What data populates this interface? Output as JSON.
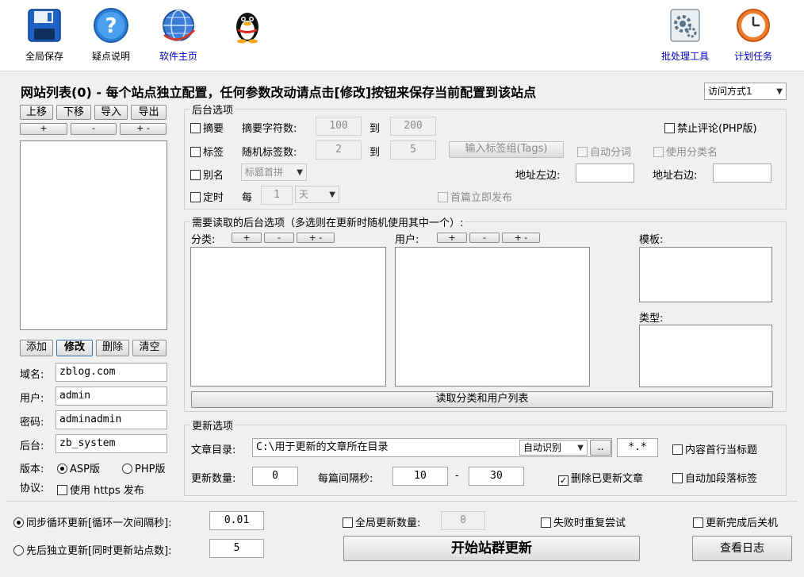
{
  "toolbar": {
    "save_all": "全局保存",
    "faq": "疑点说明",
    "homepage": "软件主页",
    "batch_tools": "批处理工具",
    "scheduled_tasks": "计划任务"
  },
  "header": {
    "title": "网站列表(0) - 每个站点独立配置，任何参数改动请点击[修改]按钮来保存当前配置到该站点",
    "access_mode": "访问方式1"
  },
  "site_list": {
    "move_up": "上移",
    "move_down": "下移",
    "import": "导入",
    "export": "导出",
    "plus": "+",
    "minus": "-",
    "plus_minus": "+ -",
    "add": "添加",
    "modify": "修改",
    "delete": "删除",
    "clear": "清空"
  },
  "site_form": {
    "domain_label": "域名:",
    "domain_value": "zblog.com",
    "user_label": "用户:",
    "user_value": "admin",
    "password_label": "密码:",
    "password_value": "adminadmin",
    "backend_label": "后台:",
    "backend_value": "zb_system",
    "version_label": "版本:",
    "version_asp": "ASP版",
    "version_php": "PHP版",
    "protocol_label": "协议:",
    "use_https": "使用 https 发布"
  },
  "backend_options": {
    "group_title": "后台选项",
    "summary": "摘要",
    "summary_chars": "摘要字符数:",
    "summary_min": "100",
    "to": "到",
    "summary_max": "200",
    "no_comment": "禁止评论(PHP版)",
    "tags": "标签",
    "random_tags": "随机标签数:",
    "tags_min": "2",
    "tags_max": "5",
    "input_tag_group": "输入标签组(Tags)",
    "auto_segment": "自动分词",
    "use_category_name": "使用分类名",
    "alias": "别名",
    "alias_mode": "标题首拼",
    "url_left": "地址左边:",
    "url_right": "地址右边:",
    "timed": "定时",
    "every": "每",
    "every_value": "1",
    "unit": "天",
    "first_publish": "首篇立即发布"
  },
  "read_options": {
    "group_title": "需要读取的后台选项（多选则在更新时随机使用其中一个）:",
    "category_label": "分类:",
    "user_label": "用户:",
    "template_label": "模板:",
    "type_label": "类型:",
    "read_button": "读取分类和用户列表"
  },
  "update_options": {
    "group_title": "更新选项",
    "article_dir_label": "文章目录:",
    "article_dir_value": "C:\\用于更新的文章所在目录",
    "encoding": "自动识别",
    "browse": "..",
    "pattern": "*.*",
    "first_line_title": "内容首行当标题",
    "update_count_label": "更新数量:",
    "update_count": "0",
    "interval_label": "每篇间隔秒:",
    "interval_min": "10",
    "dash": "-",
    "interval_max": "30",
    "delete_updated": "删除已更新文章",
    "auto_paragraph_tags": "自动加段落标签"
  },
  "bottom": {
    "sync_loop": "同步循环更新[循环一次间隔秒]:",
    "sync_interval": "0.01",
    "global_count": "全局更新数量:",
    "global_count_value": "0",
    "retry_on_fail": "失败时重复尝试",
    "shutdown_after": "更新完成后关机",
    "sequential": "先后独立更新[同时更新站点数]:",
    "concurrent_sites": "5",
    "start_button": "开始站群更新",
    "view_log": "查看日志"
  }
}
